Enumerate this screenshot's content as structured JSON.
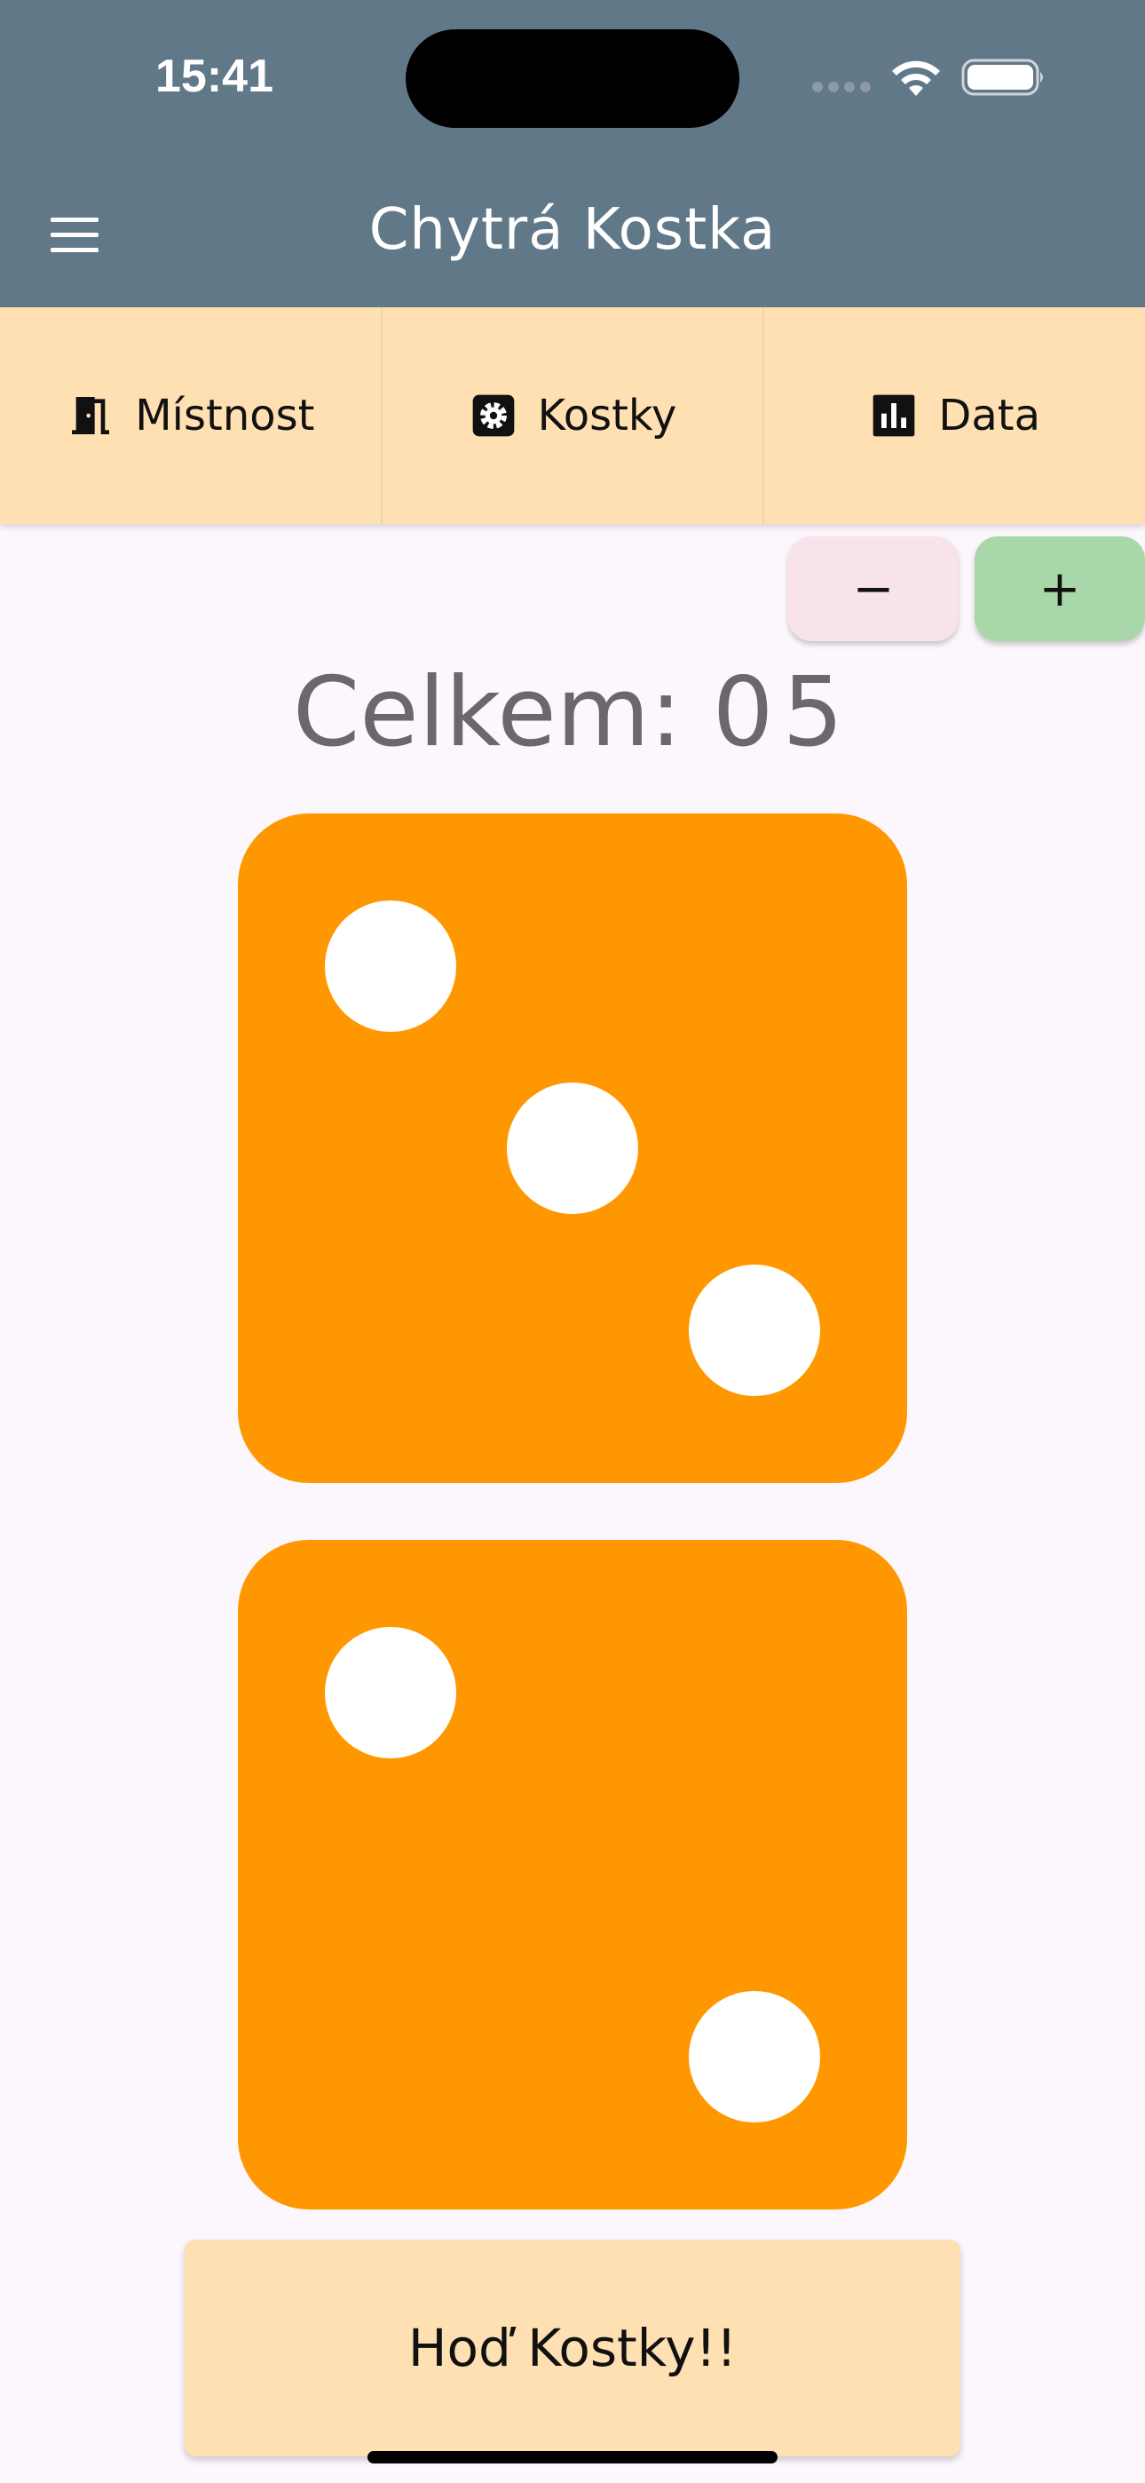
{
  "status_bar": {
    "time": "15:41",
    "icons": [
      "signal-icon",
      "wifi-icon",
      "battery-icon"
    ]
  },
  "app_bar": {
    "title": "Chytrá Kostka",
    "menu_icon": "hamburger-menu-icon",
    "color": "#617889"
  },
  "tabs": [
    {
      "label": "Místnost",
      "icon": "door-icon"
    },
    {
      "label": "Kostky",
      "icon": "gear-icon"
    },
    {
      "label": "Data",
      "icon": "bar-chart-icon"
    }
  ],
  "controls": {
    "minus_label": "−",
    "plus_label": "+"
  },
  "total": {
    "label": "Celkem:",
    "value": "05"
  },
  "dice": [
    {
      "value": 3,
      "color": "#FF9800"
    },
    {
      "value": 2,
      "color": "#FF9800"
    }
  ],
  "roll_button": {
    "label": "Hoď Kostky!!"
  },
  "colors": {
    "tab_background": "#FFE0B2",
    "page_background": "#FCF7FC",
    "minus_button": "#F9E3EA",
    "plus_button": "#A8D8A9"
  }
}
